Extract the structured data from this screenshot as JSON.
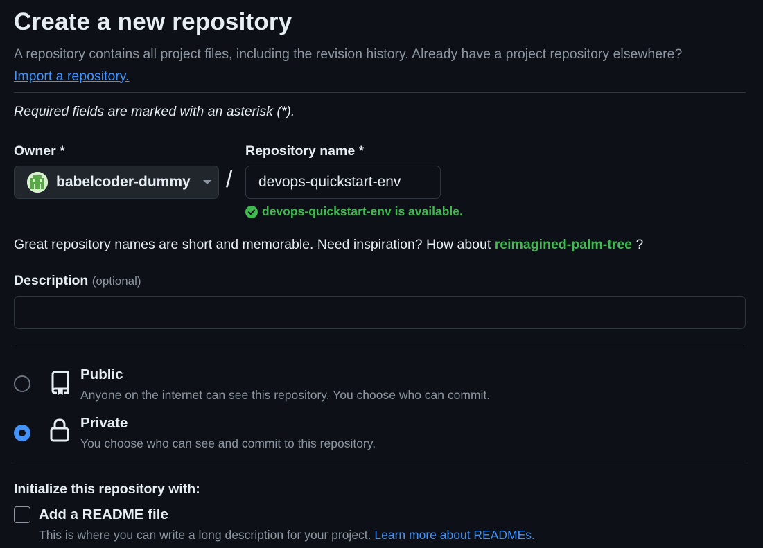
{
  "header": {
    "title": "Create a new repository",
    "intro_text": "A repository contains all project files, including the revision history. Already have a project repository elsewhere?",
    "import_link": "Import a repository."
  },
  "form": {
    "required_note": "Required fields are marked with an asterisk (*).",
    "owner": {
      "label": "Owner *",
      "value": "babelcoder-dummy"
    },
    "separator": "/",
    "repo_name": {
      "label": "Repository name *",
      "value": "devops-quickstart-env",
      "availability": "devops-quickstart-env is available."
    },
    "suggestion": {
      "prefix": "Great repository names are short and memorable. Need inspiration? How about",
      "name": "reimagined-palm-tree",
      "suffix": "?"
    },
    "description": {
      "label": "Description",
      "optional": "(optional)",
      "value": ""
    },
    "visibility": {
      "options": [
        {
          "title": "Public",
          "description": "Anyone on the internet can see this repository. You choose who can commit.",
          "checked": false,
          "icon": "repo-icon"
        },
        {
          "title": "Private",
          "description": "You choose who can see and commit to this repository.",
          "checked": true,
          "icon": "lock-icon"
        }
      ]
    },
    "initialize": {
      "heading": "Initialize this repository with:",
      "readme": {
        "title": "Add a README file",
        "description": "This is where you can write a long description for your project.",
        "link": "Learn more about READMEs.",
        "checked": false
      }
    }
  },
  "colors": {
    "background": "#0d1117",
    "accent": "#4493f8",
    "success": "#3fb950",
    "muted": "#8d96a0",
    "border": "#30363d"
  }
}
